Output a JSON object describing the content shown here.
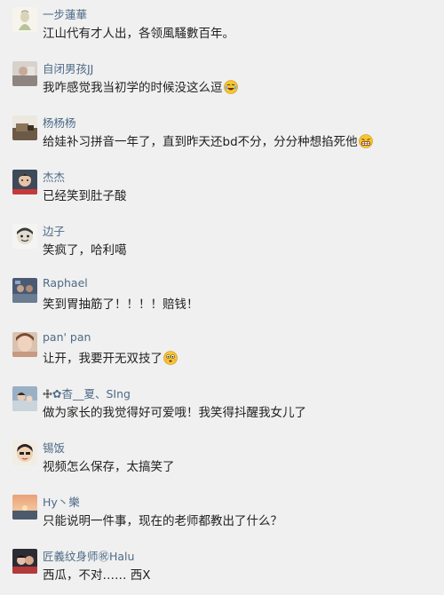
{
  "comments": [
    {
      "name": "一步蓮華",
      "text": "江山代有才人出，各领風騷數百年。"
    },
    {
      "name": "自闭男孩JJ",
      "text": "我咋感觉我当初学的时候没这么逗"
    },
    {
      "name": "杨杨杨",
      "text": "给娃补习拼音一年了，直到昨天还bd不分，分分种想掐死他"
    },
    {
      "name": "杰杰",
      "text": "已经笑到肚子酸"
    },
    {
      "name": "边子",
      "text": "笑疯了，哈利噶"
    },
    {
      "name": "Raphael",
      "text": "笑到胃抽筋了！！！！赔钱！"
    },
    {
      "name": "pan' pan",
      "text": "让开，我要开无双技了"
    },
    {
      "name": "✿杳__夏、SIng",
      "text": "做为家长的我觉得好可爱哦！我笑得抖醒我女儿了"
    },
    {
      "name": "锡饭",
      "text": "视频怎么保存，太搞笑了"
    },
    {
      "name": "Hy丶樂",
      "text": "只能说明一件事，现在的老师都教出了什么？"
    },
    {
      "name": "匠義纹身师㊗Halu",
      "text": "西瓜，不对…… 西X"
    }
  ]
}
